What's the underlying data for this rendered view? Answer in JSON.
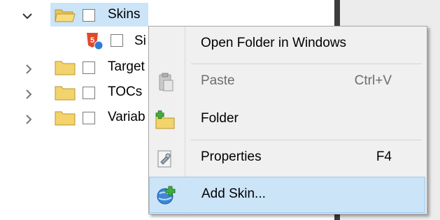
{
  "tree": {
    "items": [
      {
        "label": "Skins",
        "expanded": true,
        "selected": true
      },
      {
        "label": "Si",
        "type": "skin-file"
      },
      {
        "label": "Target",
        "expanded": false
      },
      {
        "label": "TOCs",
        "expanded": false
      },
      {
        "label": "Variab",
        "expanded": false
      }
    ]
  },
  "context_menu": {
    "items": [
      {
        "label": "Open Folder in Windows",
        "shortcut": "",
        "icon": "none",
        "enabled": true
      },
      {
        "label": "Paste",
        "shortcut": "Ctrl+V",
        "icon": "paste-icon",
        "enabled": false
      },
      {
        "label": "Folder",
        "shortcut": "",
        "icon": "new-folder-icon",
        "enabled": true
      },
      {
        "label": "Properties",
        "shortcut": "F4",
        "icon": "properties-icon",
        "enabled": true
      },
      {
        "label": "Add Skin...",
        "shortcut": "",
        "icon": "add-skin-icon",
        "enabled": true,
        "highlighted": true
      }
    ]
  },
  "colors": {
    "selection": "#cce4f7",
    "folder": "#f3d36b",
    "menu_bg": "#f0f0f0",
    "splitter": "#3d3d3d"
  }
}
